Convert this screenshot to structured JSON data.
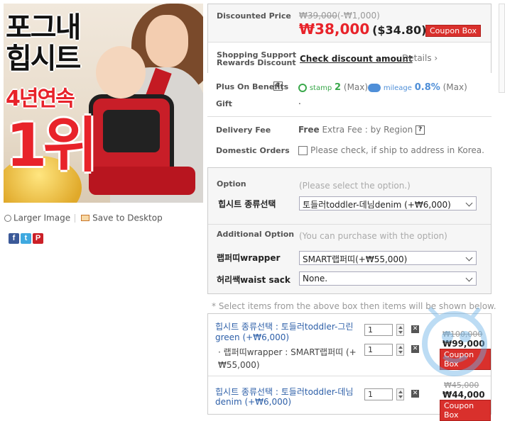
{
  "image": {
    "title_line1": "포그내",
    "title_line2": "힙시트",
    "title_line3": "4년연속",
    "title_line4": "1위",
    "larger_image": "Larger Image",
    "save_to_desktop": "Save to Desktop",
    "social": [
      "f",
      "t",
      "P"
    ]
  },
  "price": {
    "label": "Discounted Price",
    "original": "₩39,000",
    "discount": "(-₩1,000)",
    "current": "₩38,000",
    "usd": "($34.80)",
    "coupon_label": "Coupon Box",
    "rewards_label_1": "Shopping Support",
    "rewards_label_2": "Rewards Discount",
    "check_discount": "Check discount amount",
    "details": "Details ›"
  },
  "benefits": {
    "label": "Plus On Benefits",
    "help": "?",
    "stamp_label": "stamp",
    "stamp_value": "2",
    "stamp_max": "(Max)",
    "mileage_label": "mileage",
    "mileage_value": "0.8%",
    "mileage_max": "(Max)",
    "gift_label": "Gift",
    "gift_value": "."
  },
  "delivery": {
    "label": "Delivery Fee",
    "free": "Free",
    "extra": "Extra Fee : by Region",
    "help": "?",
    "domestic_label": "Domestic Orders",
    "domestic_text": "Please check, if ship to address in Korea."
  },
  "options": {
    "option_label": "Option",
    "option_hint": "(Please select the option.)",
    "hipseat_label": "힙시트 종류선택",
    "hipseat_value": "토들러toddler-데님denim (+₩6,000)",
    "additional_label": "Additional Option",
    "additional_hint": "(You can purchase with the option)",
    "wrapper_label": "랩퍼띠wrapper",
    "wrapper_value": "SMART랩퍼띠(+₩55,000)",
    "waist_label": "허리쌕waist sack",
    "waist_value": "None."
  },
  "notice": "* Select items from the above box then items will be shown below.",
  "items": [
    {
      "name_line1": "힙시트 종류선택 : 토들러toddler-그린",
      "name_line2": "green (+₩6,000)",
      "qty": "1",
      "sub_line1": "· 랩퍼띠wrapper : SMART랩퍼띠 (+",
      "sub_line2": "₩55,000)",
      "sub_qty": "1",
      "orig": "₩100,000",
      "price": "₩99,000",
      "coupon": "Coupon Box"
    },
    {
      "name_line1": "힙시트 종류선택 : 토들러toddler-데님",
      "name_line2": "denim (+₩6,000)",
      "qty": "1",
      "orig": "₩45,000",
      "price": "₩44,000",
      "coupon": "Coupon Box"
    }
  ],
  "colors": {
    "accent_red": "#e8232a",
    "coupon_red": "#d9302c",
    "link_blue": "#2d5fa8",
    "stamp_green": "#3aa84b",
    "mileage_blue": "#4f8fd8"
  }
}
